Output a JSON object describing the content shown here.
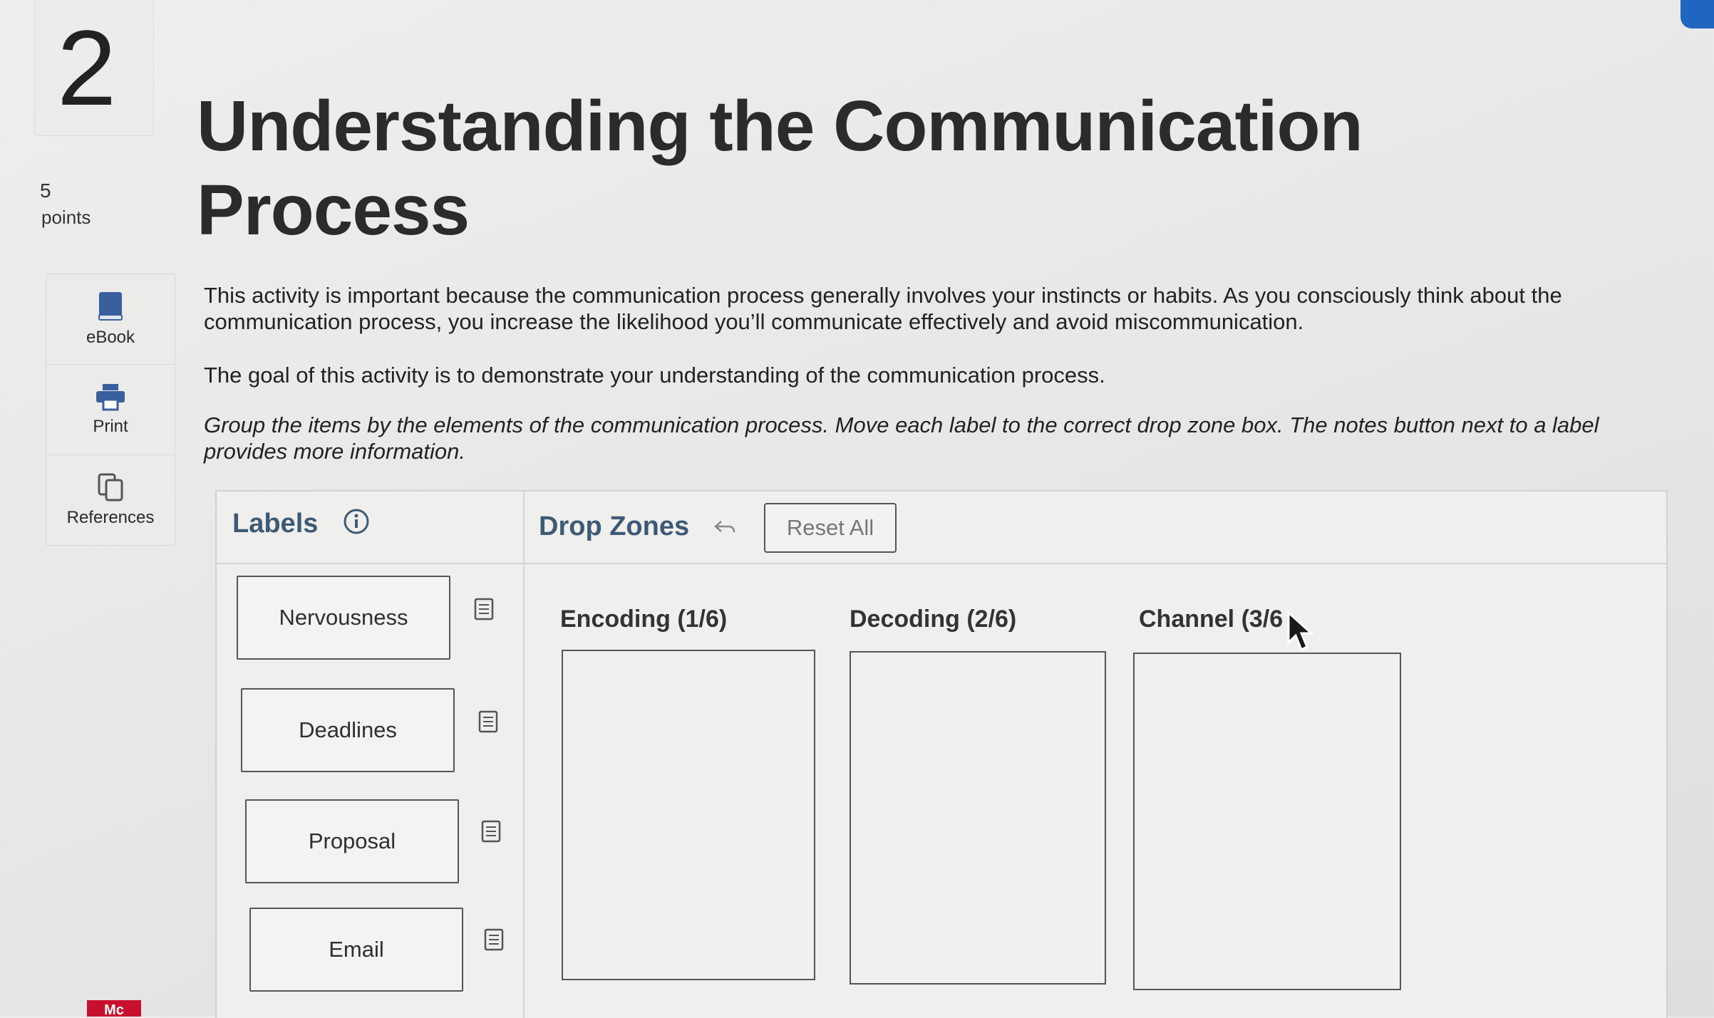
{
  "question": {
    "number": "2",
    "points_value": "5",
    "points_label": "points"
  },
  "tools": [
    {
      "label": "eBook",
      "icon": "book-icon"
    },
    {
      "label": "Print",
      "icon": "printer-icon"
    },
    {
      "label": "References",
      "icon": "copy-icon"
    }
  ],
  "title": "Understanding the Communication Process",
  "instructions": {
    "p1": "This activity is important because the communication process generally involves your instincts or habits. As you consciously think about the communication process, you increase the likelihood you’ll communicate effectively and avoid miscommunication.",
    "p2": "The goal of this activity is to demonstrate your understanding of the communication process.",
    "p3": "Group the items by the elements of the communication process. Move each label to the correct drop zone box. The notes button next to a label provides more information."
  },
  "activity": {
    "labels_title": "Labels",
    "dropzones_title": "Drop Zones",
    "reset_label": "Reset All",
    "labels": [
      {
        "text": "Nervousness"
      },
      {
        "text": "Deadlines"
      },
      {
        "text": "Proposal"
      },
      {
        "text": "Email"
      }
    ],
    "zones": [
      {
        "title": "Encoding (1/6)"
      },
      {
        "title": "Decoding (2/6)"
      },
      {
        "title": "Channel (3/6"
      }
    ]
  },
  "footer": {
    "logo_text": "Mc"
  },
  "colors": {
    "heading_blue": "#3d5a75",
    "accent_blue": "#1f66c1",
    "logo_red": "#c8102e"
  }
}
